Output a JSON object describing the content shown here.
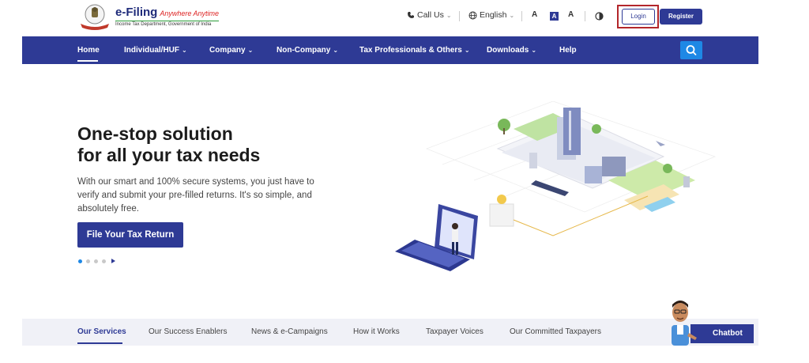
{
  "header": {
    "brand_title": "e-Filing",
    "brand_tagline": "Anywhere Anytime",
    "brand_subtitle": "Income Tax Department, Government of India",
    "call_us": "Call Us",
    "language": "English",
    "font_small": "A",
    "font_normal": "A",
    "font_large": "A",
    "login_label": "Login",
    "register_label": "Register"
  },
  "nav": {
    "items": [
      {
        "label": "Home"
      },
      {
        "label": "Individual/HUF"
      },
      {
        "label": "Company"
      },
      {
        "label": "Non-Company"
      },
      {
        "label": "Tax Professionals & Others"
      },
      {
        "label": "Downloads"
      },
      {
        "label": "Help"
      }
    ]
  },
  "hero": {
    "title_line1": "One-stop solution",
    "title_line2": "for all your tax needs",
    "description": "With our smart and 100% secure systems, you just have to verify and submit your pre-filled returns. It's so simple, and absolutely free.",
    "cta_label": "File Your Tax Return",
    "slide_count": 4,
    "active_slide": 1
  },
  "tabs": {
    "items": [
      {
        "label": "Our Services"
      },
      {
        "label": "Our Success Enablers"
      },
      {
        "label": "News & e-Campaigns"
      },
      {
        "label": "How it Works"
      },
      {
        "label": "Taxpayer Voices"
      },
      {
        "label": "Our Committed Taxpayers"
      }
    ]
  },
  "chatbot_label": "Chatbot",
  "colors": {
    "primary": "#2e3a95",
    "accent": "#1e88e5",
    "highlight": "#b3262b"
  }
}
